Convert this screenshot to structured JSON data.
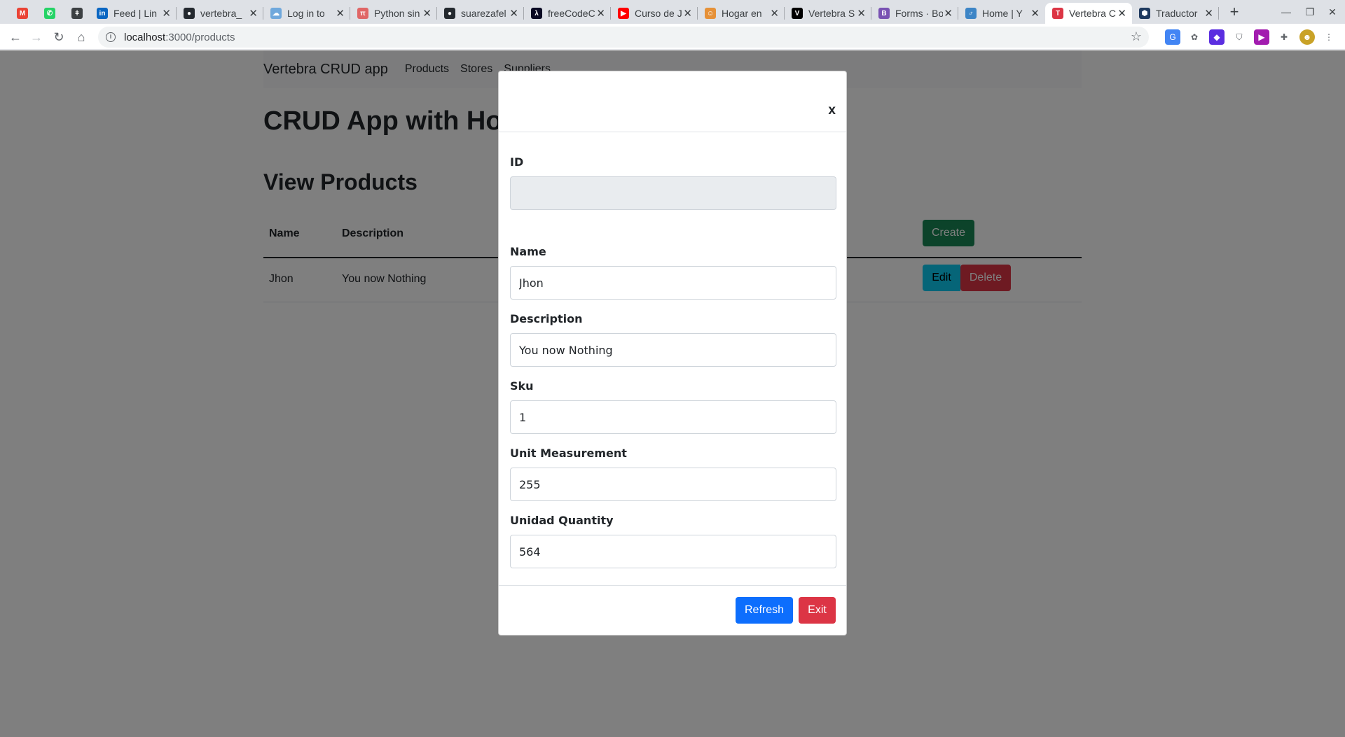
{
  "browser": {
    "tabs": [
      {
        "title": "",
        "icon": "gmail-icon",
        "color": "#ea4335",
        "glyph": "M"
      },
      {
        "title": "",
        "icon": "whatsapp-icon",
        "color": "#25d366",
        "glyph": "✆"
      },
      {
        "title": "",
        "icon": "bolt-icon",
        "color": "#3c4043",
        "glyph": "ǂ"
      },
      {
        "title": "Feed | Lin",
        "icon": "linkedin-icon",
        "color": "#0a66c2",
        "glyph": "in"
      },
      {
        "title": "vertebra_",
        "icon": "github-icon",
        "color": "#24292f",
        "glyph": "●"
      },
      {
        "title": "Log in to",
        "icon": "cloud-icon",
        "color": "#6fa8dc",
        "glyph": "☁"
      },
      {
        "title": "Python sin",
        "icon": "python-icon",
        "color": "#e06666",
        "glyph": "π"
      },
      {
        "title": "suarezafel",
        "icon": "github-icon",
        "color": "#24292f",
        "glyph": "●"
      },
      {
        "title": "freeCodeC",
        "icon": "freecodecamp-icon",
        "color": "#0a0a23",
        "glyph": "λ"
      },
      {
        "title": "Curso de J",
        "icon": "youtube-icon",
        "color": "#ff0000",
        "glyph": "▶"
      },
      {
        "title": "Hogar en",
        "icon": "home-app-icon",
        "color": "#e69138",
        "glyph": "☺"
      },
      {
        "title": "Vertebra S",
        "icon": "vertebra-icon",
        "color": "#000000",
        "glyph": "V"
      },
      {
        "title": "Forms · Bo",
        "icon": "bootstrap-icon",
        "color": "#7952b3",
        "glyph": "B"
      },
      {
        "title": "Home | Y",
        "icon": "y-icon",
        "color": "#3d85c6",
        "glyph": "♂"
      },
      {
        "title": "Vertebra C",
        "icon": "vertebra-crud-icon",
        "color": "#dc3545",
        "glyph": "T"
      },
      {
        "title": "Traductor",
        "icon": "translator-icon",
        "color": "#1f3a5f",
        "glyph": "⬢"
      }
    ],
    "url_host": "localhost",
    "url_path": ":3000/products"
  },
  "navbar": {
    "brand": "Vertebra CRUD app",
    "links": [
      "Products",
      "Stores",
      "Suppliers"
    ]
  },
  "page": {
    "title": "CRUD App with Hoo",
    "subtitle": "View Products"
  },
  "table": {
    "headers": [
      "Name",
      "Description"
    ],
    "create_label": "Create",
    "rows": [
      {
        "name": "Jhon",
        "description": "You now Nothing",
        "edit_label": "Edit",
        "delete_label": "Delete"
      }
    ]
  },
  "modal": {
    "close_label": "x",
    "fields": [
      {
        "label": "ID",
        "value": "",
        "disabled": true
      },
      {
        "label": "Name",
        "value": "Jhon"
      },
      {
        "label": "Description",
        "value": "You now Nothing"
      },
      {
        "label": "Sku",
        "value": "1"
      },
      {
        "label": "Unit Measurement",
        "value": "255"
      },
      {
        "label": "Unidad Quantity",
        "value": "564"
      }
    ],
    "refresh_label": "Refresh",
    "exit_label": "Exit"
  },
  "colors": {
    "primary": "#0d6efd",
    "danger": "#dc3545",
    "success": "#198754",
    "info": "#0dcaf0"
  }
}
